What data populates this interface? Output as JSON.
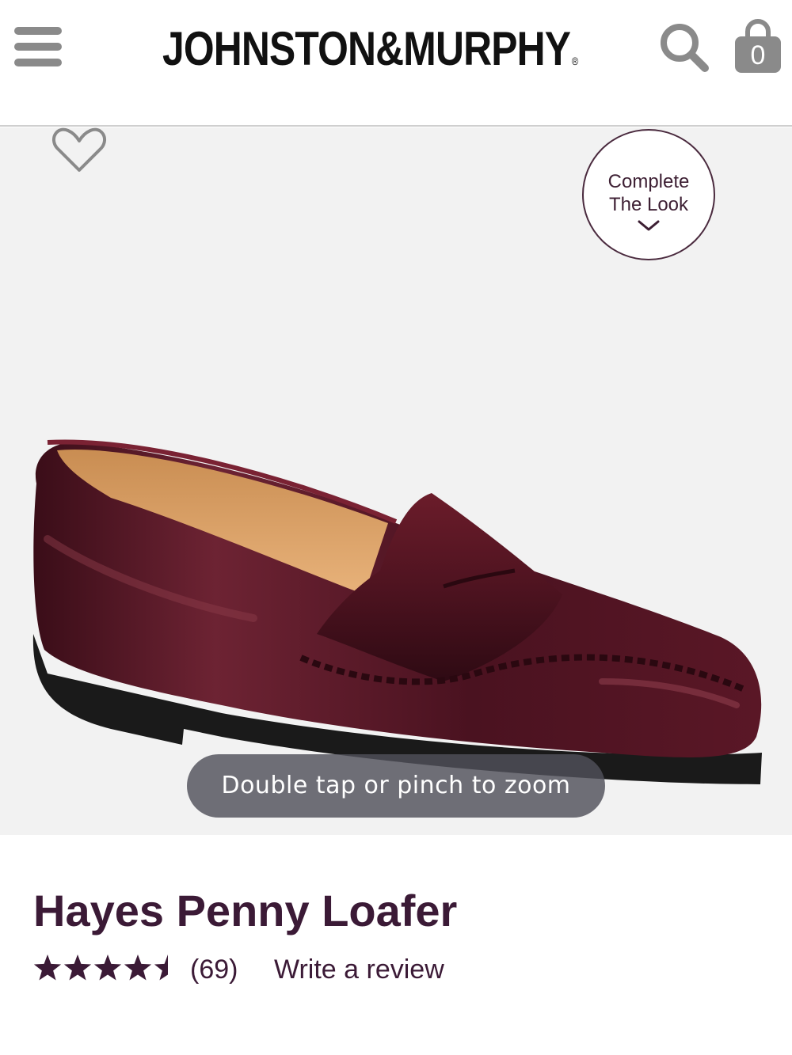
{
  "header": {
    "brand": "JOHNSTON&MURPHY",
    "brand_mark": "®",
    "bag_count": "0",
    "menu_icon": "hamburger-menu-icon",
    "search_icon": "search-icon",
    "bag_icon": "shopping-bag-icon"
  },
  "hero": {
    "favorite_icon": "heart-icon",
    "complete_look_line1": "Complete",
    "complete_look_line2": "The Look",
    "complete_look_icon": "chevron-down-icon",
    "zoom_hint": "Double tap or pinch to zoom",
    "image_subject": "burgundy penny loafer"
  },
  "product": {
    "title": "Hayes Penny Loafer",
    "rating": 4.5,
    "rating_max": 5,
    "review_count": "(69)",
    "write_review_label": "Write a review"
  },
  "colors": {
    "brand_text": "#111111",
    "accent_plum": "#3b1a36",
    "image_background": "#f2f2f2",
    "icon_gray": "#8a8a8a",
    "zoom_hint_bg": "#50505a"
  }
}
